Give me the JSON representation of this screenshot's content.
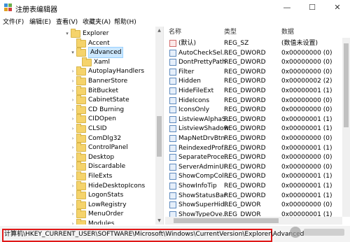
{
  "window": {
    "title": "注册表编辑器"
  },
  "menu": [
    "文件(F)",
    "编辑(E)",
    "查看(V)",
    "收藏夹(A)",
    "帮助(H)"
  ],
  "tree": {
    "rows": [
      {
        "label": "Explorer",
        "level": 0,
        "chevron": "▾"
      },
      {
        "label": "Accent",
        "level": 1,
        "chevron": ""
      },
      {
        "label": "Advanced",
        "level": 1,
        "chevron": "▾",
        "selected": true
      },
      {
        "label": "Xaml",
        "level": 2,
        "chevron": ""
      },
      {
        "label": "AutoplayHandlers",
        "level": 1,
        "chevron": "›"
      },
      {
        "label": "BannerStore",
        "level": 1,
        "chevron": "›"
      },
      {
        "label": "BitBucket",
        "level": 1,
        "chevron": "›"
      },
      {
        "label": "CabinetState",
        "level": 1,
        "chevron": "›"
      },
      {
        "label": "CD Burning",
        "level": 1,
        "chevron": "›"
      },
      {
        "label": "CIDOpen",
        "level": 1,
        "chevron": "›"
      },
      {
        "label": "CLSID",
        "level": 1,
        "chevron": "›"
      },
      {
        "label": "ComDlg32",
        "level": 1,
        "chevron": "›"
      },
      {
        "label": "ControlPanel",
        "level": 1,
        "chevron": "›"
      },
      {
        "label": "Desktop",
        "level": 1,
        "chevron": "›"
      },
      {
        "label": "Discardable",
        "level": 1,
        "chevron": "›"
      },
      {
        "label": "FileExts",
        "level": 1,
        "chevron": "›"
      },
      {
        "label": "HideDesktopIcons",
        "level": 1,
        "chevron": "›"
      },
      {
        "label": "LogonStats",
        "level": 1,
        "chevron": "›"
      },
      {
        "label": "LowRegistry",
        "level": 1,
        "chevron": "›"
      },
      {
        "label": "MenuOrder",
        "level": 1,
        "chevron": "›"
      },
      {
        "label": "Modules",
        "level": 1,
        "chevron": "›"
      }
    ]
  },
  "values": {
    "headers": {
      "name": "名称",
      "type": "类型",
      "data": "数据"
    },
    "rows": [
      {
        "name": "(默认)",
        "type": "REG_SZ",
        "data": "(数值未设置)",
        "kind": "sz"
      },
      {
        "name": "AutoCheckSel...",
        "type": "REG_DWORD",
        "data": "0x00000000 (0)",
        "kind": "dword"
      },
      {
        "name": "DontPrettyPath",
        "type": "REG_DWORD",
        "data": "0x00000000 (0)",
        "kind": "dword"
      },
      {
        "name": "Filter",
        "type": "REG_DWORD",
        "data": "0x00000000 (0)",
        "kind": "dword"
      },
      {
        "name": "Hidden",
        "type": "REG_DWORD",
        "data": "0x00000002 (2)",
        "kind": "dword"
      },
      {
        "name": "HideFileExt",
        "type": "REG_DWORD",
        "data": "0x00000001 (1)",
        "kind": "dword"
      },
      {
        "name": "HideIcons",
        "type": "REG_DWORD",
        "data": "0x00000000 (0)",
        "kind": "dword"
      },
      {
        "name": "IconsOnly",
        "type": "REG_DWORD",
        "data": "0x00000000 (0)",
        "kind": "dword"
      },
      {
        "name": "ListviewAlphaS...",
        "type": "REG_DWORD",
        "data": "0x00000001 (1)",
        "kind": "dword"
      },
      {
        "name": "ListviewShadow",
        "type": "REG_DWORD",
        "data": "0x00000001 (1)",
        "kind": "dword"
      },
      {
        "name": "MapNetDrvBtn",
        "type": "REG_DWORD",
        "data": "0x00000000 (0)",
        "kind": "dword"
      },
      {
        "name": "ReindexedProf...",
        "type": "REG_DWORD",
        "data": "0x00000001 (1)",
        "kind": "dword"
      },
      {
        "name": "SeparateProce...",
        "type": "REG_DWORD",
        "data": "0x00000000 (0)",
        "kind": "dword"
      },
      {
        "name": "ServerAdminUI",
        "type": "REG_DWORD",
        "data": "0x00000000 (0)",
        "kind": "dword"
      },
      {
        "name": "ShowCompCol...",
        "type": "REG_DWORD",
        "data": "0x00000001 (1)",
        "kind": "dword"
      },
      {
        "name": "ShowInfoTip",
        "type": "REG_DWORD",
        "data": "0x00000001 (1)",
        "kind": "dword"
      },
      {
        "name": "ShowStatusBar",
        "type": "REG_DWORD",
        "data": "0x00000001 (1)",
        "kind": "dword"
      },
      {
        "name": "ShowSuperHid...",
        "type": "REG_DWOR",
        "data": "0x00000000 (0)",
        "kind": "dword"
      },
      {
        "name": "ShowTypeOve...",
        "type": "REG_DWOR",
        "data": "0x00000001 (1)",
        "kind": "dword"
      }
    ]
  },
  "status": {
    "path": "计算机\\HKEY_CURRENT_USER\\SOFTWARE\\Microsoft\\Windows\\CurrentVersion\\Explorer\\Advanced"
  },
  "colors": {
    "highlight": "#e01818",
    "selection": "#cce8ff",
    "folder": "#f5d36b"
  }
}
